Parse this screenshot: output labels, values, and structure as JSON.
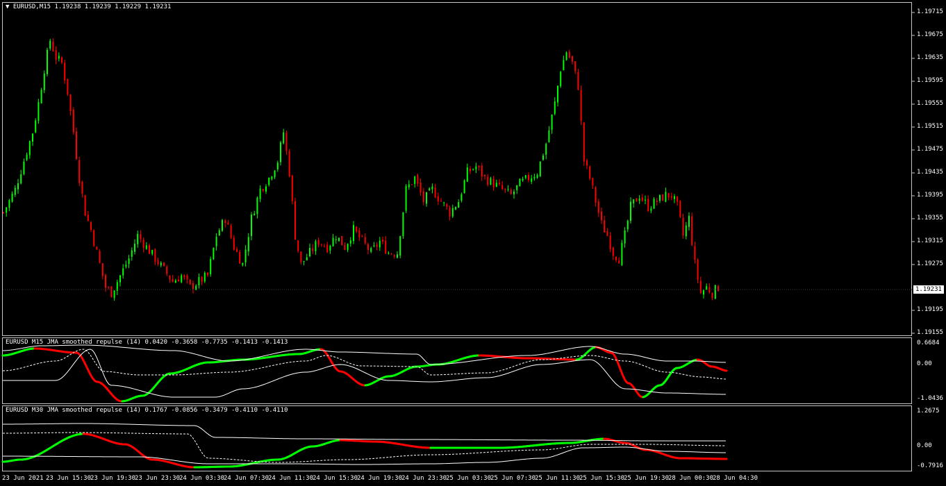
{
  "main_title": "EURUSD,M15  1.19238 1.19239 1.19229 1.19231",
  "ind1_title": "EURUSD M15 JMA smoothed repulse (14) 0.0420 -0.3658 -0.7735 -0.1413 -0.1413",
  "ind2_title": "EURUSD M30 JMA smoothed repulse (14) 0.1767 -0.0856 -0.3479 -0.4110 -0.4110",
  "current_price": "1.19231",
  "price_axis": [
    "1.19715",
    "1.19675",
    "1.19635",
    "1.19595",
    "1.19555",
    "1.19515",
    "1.19475",
    "1.19435",
    "1.19395",
    "1.19355",
    "1.19315",
    "1.19275",
    "1.19195",
    "1.19155"
  ],
  "ind1_axis": [
    "0.6684",
    "0.00",
    "-1.0436"
  ],
  "ind2_axis": [
    "1.2675",
    "0.00",
    "-0.7916"
  ],
  "time_axis": [
    "23 Jun 2021",
    "23 Jun 15:30",
    "23 Jun 19:30",
    "23 Jun 23:30",
    "24 Jun 03:30",
    "24 Jun 07:30",
    "24 Jun 11:30",
    "24 Jun 15:30",
    "24 Jun 19:30",
    "24 Jun 23:30",
    "25 Jun 03:30",
    "25 Jun 07:30",
    "25 Jun 11:30",
    "25 Jun 15:30",
    "25 Jun 19:30",
    "28 Jun 00:30",
    "28 Jun 04:30"
  ],
  "colors": {
    "bull": "#00ff00",
    "bear": "#ff0000",
    "line": "#ffffff",
    "bg": "#000000",
    "axis": "#c8c8c8"
  },
  "chart_data": {
    "type": "candlestick",
    "symbol": "EURUSD",
    "timeframe": "M15",
    "ylim": [
      1.19145,
      1.19725
    ],
    "last": {
      "open": 1.19238,
      "high": 1.19239,
      "low": 1.19229,
      "close": 1.19231
    },
    "close_path": [
      [
        0,
        1.1936
      ],
      [
        4,
        1.194
      ],
      [
        7,
        1.1945
      ],
      [
        10,
        1.195
      ],
      [
        12,
        1.1955
      ],
      [
        14,
        1.1961
      ],
      [
        16,
        1.1966
      ],
      [
        18,
        1.1963
      ],
      [
        20,
        1.1962
      ],
      [
        22,
        1.1957
      ],
      [
        24,
        1.195
      ],
      [
        26,
        1.1942
      ],
      [
        28,
        1.1936
      ],
      [
        30,
        1.1933
      ],
      [
        33,
        1.1927
      ],
      [
        35,
        1.1923
      ],
      [
        37,
        1.1922
      ],
      [
        40,
        1.1925
      ],
      [
        43,
        1.1928
      ],
      [
        46,
        1.1932
      ],
      [
        49,
        1.193
      ],
      [
        52,
        1.1928
      ],
      [
        55,
        1.1926
      ],
      [
        58,
        1.1924
      ],
      [
        61,
        1.1925
      ],
      [
        64,
        1.1923
      ],
      [
        67,
        1.1924
      ],
      [
        70,
        1.1925
      ],
      [
        73,
        1.1932
      ],
      [
        76,
        1.1935
      ],
      [
        79,
        1.193
      ],
      [
        82,
        1.1927
      ],
      [
        85,
        1.1935
      ],
      [
        88,
        1.194
      ],
      [
        91,
        1.1942
      ],
      [
        94,
        1.1945
      ],
      [
        96,
        1.195
      ],
      [
        98,
        1.1943
      ],
      [
        100,
        1.1932
      ],
      [
        102,
        1.1927
      ],
      [
        105,
        1.1929
      ],
      [
        108,
        1.1931
      ],
      [
        111,
        1.193
      ],
      [
        114,
        1.1932
      ],
      [
        117,
        1.193
      ],
      [
        120,
        1.1933
      ],
      [
        123,
        1.1931
      ],
      [
        126,
        1.1929
      ],
      [
        129,
        1.1931
      ],
      [
        132,
        1.1929
      ],
      [
        135,
        1.1929
      ],
      [
        138,
        1.194
      ],
      [
        141,
        1.1942
      ],
      [
        144,
        1.1938
      ],
      [
        147,
        1.194
      ],
      [
        150,
        1.1938
      ],
      [
        153,
        1.1936
      ],
      [
        156,
        1.1938
      ],
      [
        159,
        1.1943
      ],
      [
        162,
        1.1944
      ],
      [
        165,
        1.1942
      ],
      [
        168,
        1.1941
      ],
      [
        171,
        1.194
      ],
      [
        174,
        1.1939
      ],
      [
        177,
        1.1941
      ],
      [
        180,
        1.1942
      ],
      [
        183,
        1.1943
      ],
      [
        186,
        1.1948
      ],
      [
        189,
        1.1955
      ],
      [
        191,
        1.1961
      ],
      [
        193,
        1.1964
      ],
      [
        195,
        1.1962
      ],
      [
        197,
        1.1958
      ],
      [
        199,
        1.1945
      ],
      [
        201,
        1.1942
      ],
      [
        203,
        1.1938
      ],
      [
        205,
        1.1934
      ],
      [
        207,
        1.1932
      ],
      [
        209,
        1.1929
      ],
      [
        211,
        1.1928
      ],
      [
        213,
        1.1932
      ],
      [
        215,
        1.1937
      ],
      [
        218,
        1.1939
      ],
      [
        221,
        1.1937
      ],
      [
        224,
        1.1938
      ],
      [
        227,
        1.1939
      ],
      [
        229,
        1.1939
      ],
      [
        231,
        1.1937
      ],
      [
        233,
        1.1932
      ],
      [
        235,
        1.1935
      ],
      [
        237,
        1.1927
      ],
      [
        239,
        1.1922
      ],
      [
        241,
        1.1923
      ],
      [
        243,
        1.1922
      ],
      [
        245,
        1.1923
      ]
    ],
    "indicator_m15": {
      "title": "JMA smoothed repulse (14)",
      "values": [
        0.042,
        -0.3658,
        -0.7735,
        -0.1413,
        -0.1413
      ],
      "ylim": [
        -1.0436,
        0.6684
      ]
    },
    "indicator_m30": {
      "title": "JMA smoothed repulse (14)",
      "values": [
        0.1767,
        -0.0856,
        -0.3479,
        -0.411,
        -0.411
      ],
      "ylim": [
        -0.7916,
        1.2675
      ]
    }
  }
}
